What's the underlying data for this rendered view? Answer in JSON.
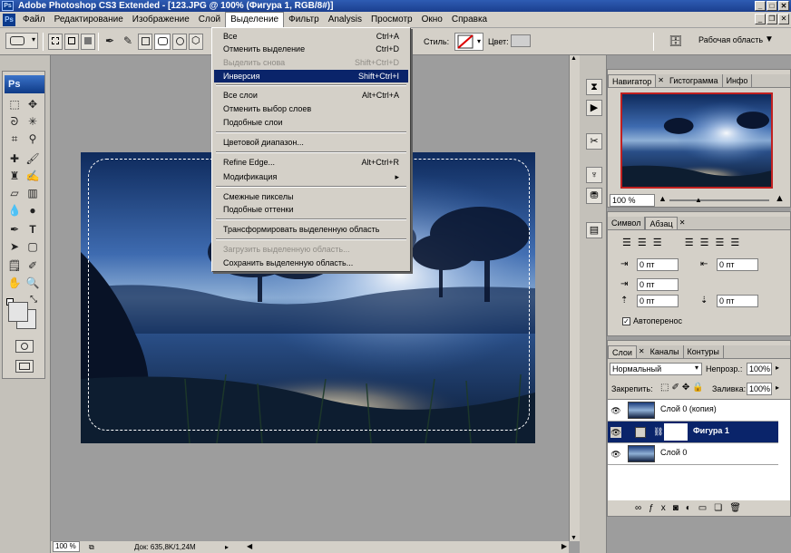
{
  "window": {
    "title": "Adobe Photoshop CS3 Extended - [123.JPG @ 100% (Фигура 1, RGB/8#)]",
    "logo": "Ps"
  },
  "menubar": {
    "items": [
      "Файл",
      "Редактирование",
      "Изображение",
      "Слой",
      "Выделение",
      "Фильтр",
      "Analysis",
      "Просмотр",
      "Окно",
      "Справка"
    ],
    "active": "Выделение"
  },
  "options": {
    "style_label": "Стиль:",
    "color_label": "Цвет:",
    "workspace_label": "Рабочая область"
  },
  "selection_menu": {
    "items": [
      {
        "label": "Все",
        "shortcut": "Ctrl+A"
      },
      {
        "label": "Отменить выделение",
        "shortcut": "Ctrl+D"
      },
      {
        "label": "Выделить снова",
        "shortcut": "Shift+Ctrl+D"
      },
      {
        "label": "Инверсия",
        "shortcut": "Shift+Ctrl+I"
      },
      {
        "label": "Все слои",
        "shortcut": "Alt+Ctrl+A"
      },
      {
        "label": "Отменить выбор слоев",
        "shortcut": ""
      },
      {
        "label": "Подобные слои",
        "shortcut": ""
      },
      {
        "label": "Цветовой диапазон...",
        "shortcut": ""
      },
      {
        "label": "Refine Edge...",
        "shortcut": "Alt+Ctrl+R"
      },
      {
        "label": "Модификация",
        "shortcut": "▸"
      },
      {
        "label": "Смежные пикселы",
        "shortcut": ""
      },
      {
        "label": "Подобные оттенки",
        "shortcut": ""
      },
      {
        "label": "Трансформировать выделенную область",
        "shortcut": ""
      },
      {
        "label": "Загрузить выделенную область...",
        "shortcut": ""
      },
      {
        "label": "Сохранить выделенную область...",
        "shortcut": ""
      }
    ]
  },
  "navigator": {
    "tabs": [
      "Навигатор",
      "Гистограмма",
      "Инфо"
    ],
    "zoom": "100 %"
  },
  "paragraph": {
    "tabs": [
      "Символ",
      "Абзац"
    ],
    "indent_left": "0 пт",
    "indent_right": "0 пт",
    "indent_first": "0 пт",
    "space_before": "0 пт",
    "space_after": "0 пт",
    "space_after2": "0 пт",
    "hyphenate": "Автоперенос"
  },
  "layers": {
    "tabs": [
      "Слои",
      "Каналы",
      "Контуры"
    ],
    "blend_mode": "Нормальный",
    "opacity_label": "Непрозр.:",
    "opacity": "100%",
    "lock_label": "Закрепить:",
    "fill_label": "Заливка:",
    "fill": "100%",
    "items": [
      {
        "name": "Слой 0 (копия)",
        "selected": false
      },
      {
        "name": "Фигура 1",
        "selected": true
      },
      {
        "name": "Слой 0",
        "selected": false
      }
    ]
  },
  "status": {
    "zoom": "100 %",
    "doc": "Док: 635,8K/1,24M"
  }
}
